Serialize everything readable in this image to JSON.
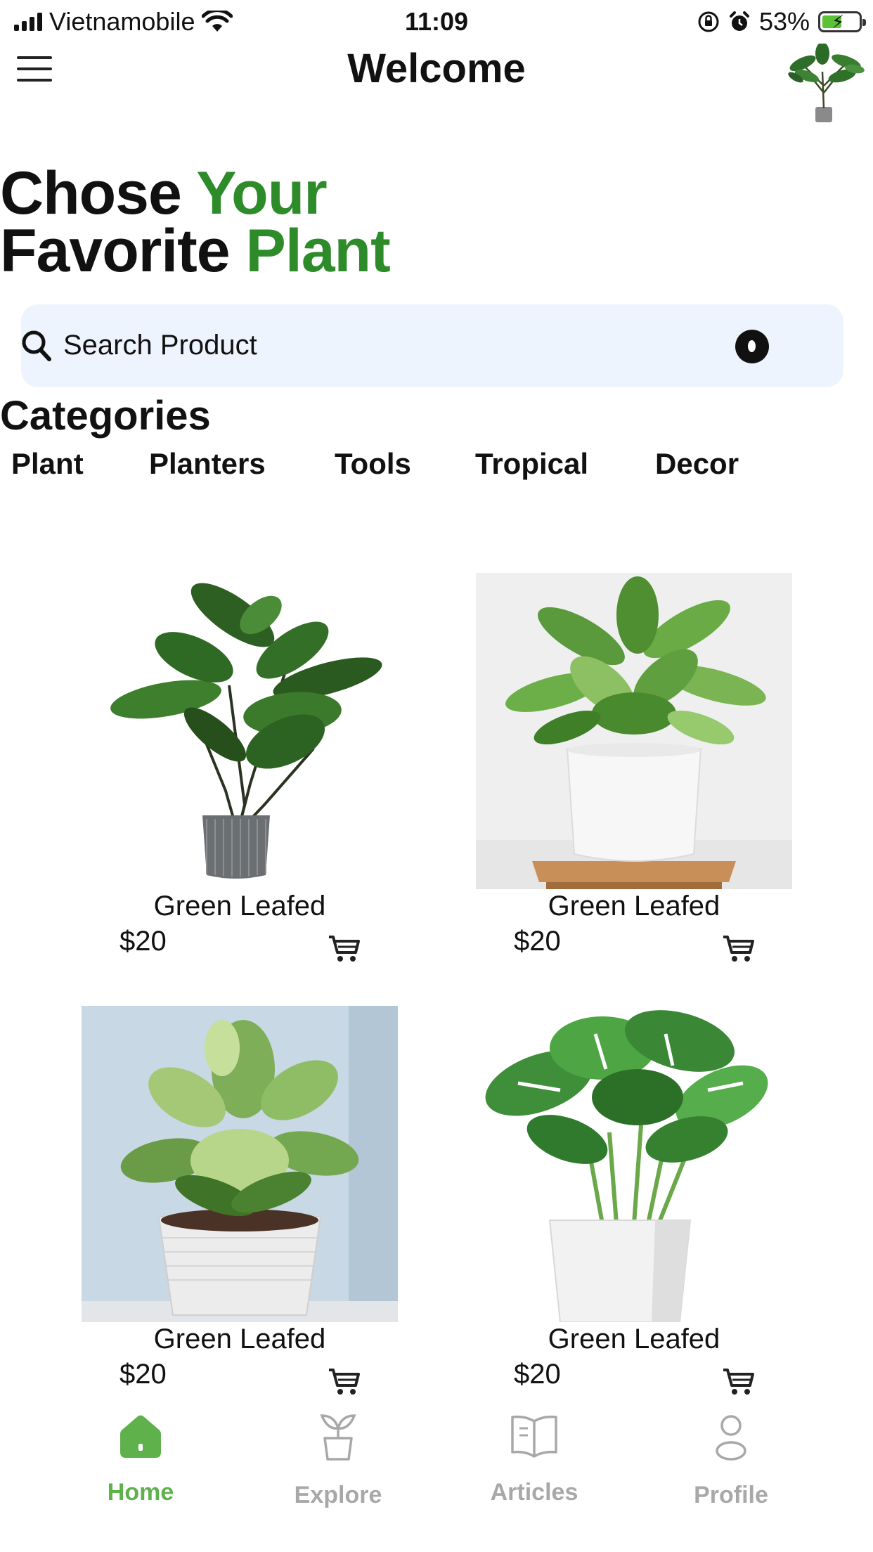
{
  "status_bar": {
    "carrier": "Vietnamobile",
    "time": "11:09",
    "battery": "53%",
    "battery_level": 0.53
  },
  "header": {
    "title": "Welcome"
  },
  "hero": {
    "line1_a": "Chose",
    "line1_b": "Your",
    "line2_a": "Favorite",
    "line2_b": "Plant"
  },
  "search": {
    "placeholder": "Search Product"
  },
  "categories": {
    "title": "Categories",
    "items": [
      "Plant",
      "Planters",
      "Tools",
      "Tropical",
      "Decor"
    ]
  },
  "products": [
    {
      "name": "Green Leafed",
      "price": "$20"
    },
    {
      "name": "Green Leafed",
      "price": "$20"
    },
    {
      "name": "Green Leafed",
      "price": "$20"
    },
    {
      "name": "Green Leafed",
      "price": "$20"
    }
  ],
  "bottom_nav": [
    {
      "label": "Home",
      "icon": "home-icon",
      "active": true
    },
    {
      "label": "Explore",
      "icon": "plant-pot-icon",
      "active": false
    },
    {
      "label": "Articles",
      "icon": "book-icon",
      "active": false
    },
    {
      "label": "Profile",
      "icon": "person-icon",
      "active": false
    }
  ],
  "colors": {
    "accent": "#2e8b2a",
    "nav_active": "#5fb14c",
    "nav_inactive": "#a8a8a8",
    "search_bg": "#eef4fd"
  }
}
